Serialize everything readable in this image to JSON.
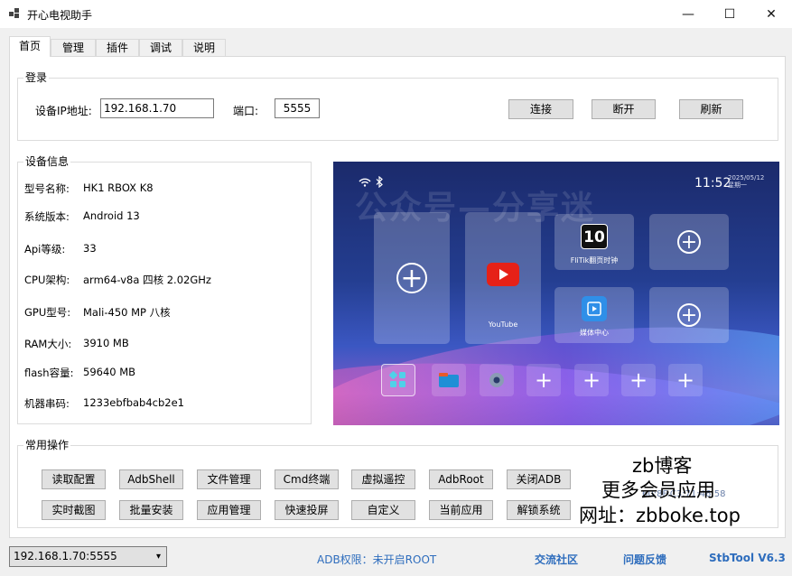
{
  "window": {
    "title": "开心电视助手",
    "minimize_glyph": "—",
    "maximize_glyph": "☐",
    "close_glyph": "✕"
  },
  "tabs": [
    {
      "label": "首页",
      "active": true
    },
    {
      "label": "管理",
      "active": false
    },
    {
      "label": "插件",
      "active": false
    },
    {
      "label": "调试",
      "active": false
    },
    {
      "label": "说明",
      "active": false
    }
  ],
  "login": {
    "group_label": "登录",
    "ip_label": "设备IP地址:",
    "ip_value": "192.168.1.70",
    "port_label": "端口:",
    "port_value": "5555",
    "connect_button": "连接",
    "disconnect_button": "断开",
    "refresh_button": "刷新"
  },
  "device_info": {
    "group_label": "设备信息",
    "rows": [
      {
        "key": "型号名称:",
        "value": "HK1 RBOX K8"
      },
      {
        "key": "系统版本:",
        "value": "Android 13"
      },
      {
        "key": "Api等级:",
        "value": "33"
      },
      {
        "key": "CPU架构:",
        "value": "arm64-v8a 四核 2.02GHz"
      },
      {
        "key": "GPU型号:",
        "value": "Mali-450 MP 八核"
      },
      {
        "key": "RAM大小:",
        "value": "3910 MB"
      },
      {
        "key": "flash容量:",
        "value": "59640 MB"
      },
      {
        "key": "机器串码:",
        "value": "1233ebfbab4cb2e1"
      }
    ]
  },
  "preview": {
    "watermark": "公众号—分享迷",
    "time": "11:52",
    "date": "2025/05/12",
    "weekday": "星期一",
    "youtube_label": "YouTube",
    "clock_app_label": "FliTik翻页时钟",
    "clock_app_icon": "10",
    "media_label": "媒体中心"
  },
  "operations": {
    "group_label": "常用操作",
    "row1": [
      "读取配置",
      "AdbShell",
      "文件管理",
      "Cmd终端",
      "虚拟遥控",
      "AdbRoot",
      "关闭ADB"
    ],
    "row2": [
      "实时截图",
      "批量安装",
      "应用管理",
      "快速投屏",
      "自定义",
      "当前应用",
      "解锁系统"
    ]
  },
  "promo": {
    "line1": "zb博客",
    "line2": "更多会员应用",
    "line3": "网址：zbboke.top",
    "faint": "60:8F:C3:71:46:58"
  },
  "statusbar": {
    "device_select": "192.168.1.70:5555",
    "adb_status": "ADB权限：未开启ROOT",
    "community_link": "交流社区",
    "feedback_link": "问题反馈",
    "version": "StbTool V6.3"
  },
  "colors": {
    "link": "#2e6dbd",
    "button_bg": "#e1e1e1",
    "youtube_red": "#e62117",
    "media_blue": "#2f8fe8"
  }
}
